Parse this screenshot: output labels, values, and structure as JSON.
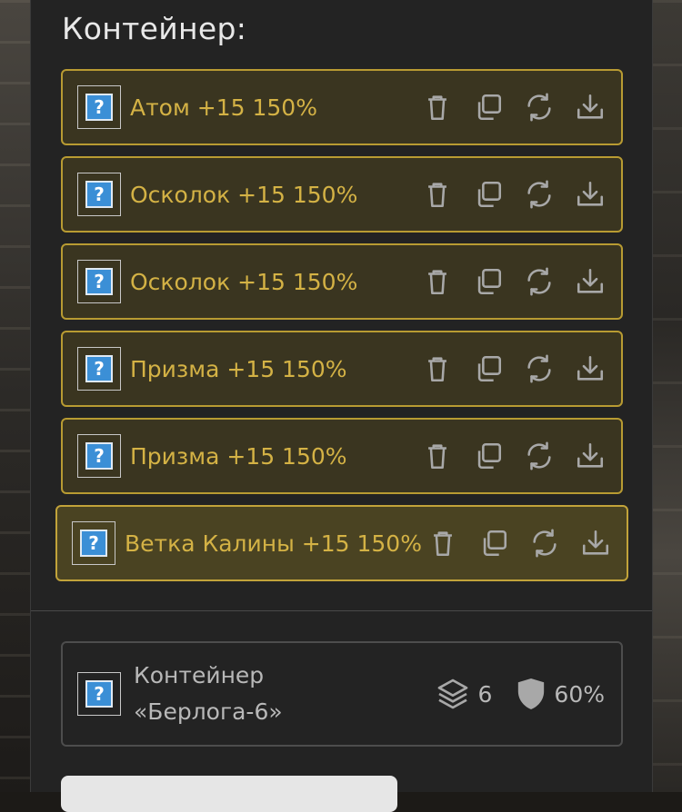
{
  "panel": {
    "title": "Контейнер:"
  },
  "items": [
    {
      "name": "Атом +15 150%"
    },
    {
      "name": "Осколок +15 150%"
    },
    {
      "name": "Осколок +15 150%"
    },
    {
      "name": "Призма +15 150%"
    },
    {
      "name": "Призма +15 150%"
    },
    {
      "name": "Ветка Калины +15 150%"
    }
  ],
  "item_icon_glyph": "?",
  "icons": [
    "trash-icon",
    "copy-icon",
    "refresh-icon",
    "download-icon"
  ],
  "container": {
    "name_line1": "Контейнер",
    "name_line2": "«Берлога-6»",
    "layers_count": "6",
    "protection": "60%"
  },
  "colors": {
    "accent": "#d4b245",
    "item_border": "#b89b32",
    "item_bg": "#3a3520",
    "icon_gray": "#a8a8a8"
  }
}
